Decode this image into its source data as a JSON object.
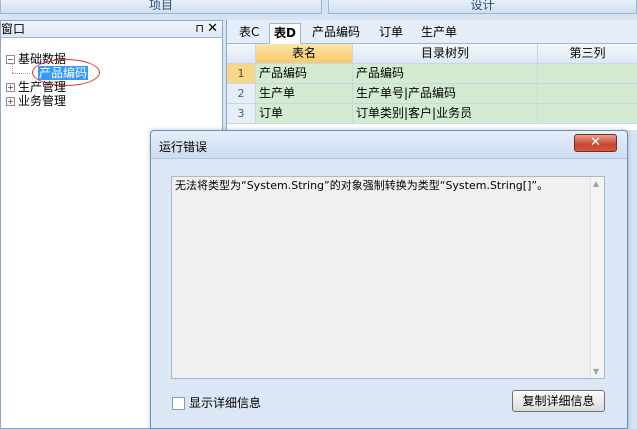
{
  "top_tabs": {
    "project": "项目",
    "design": "设计"
  },
  "left_panel": {
    "title": "窗口",
    "pin_icon": "⊓",
    "close_icon": "✕",
    "tree": [
      {
        "label": "基础数据",
        "expander": "−"
      },
      {
        "label": "产品编码"
      },
      {
        "label": "生产管理",
        "expander": "+"
      },
      {
        "label": "业务管理",
        "expander": "+"
      }
    ]
  },
  "doc_tabs": [
    "表C",
    "表D",
    "产品编码",
    "订单",
    "生产单"
  ],
  "grid": {
    "headers": [
      "表名",
      "目录树列",
      "第三列"
    ],
    "rows": [
      {
        "num": "1",
        "name": "产品编码",
        "tree_col": "产品编码",
        "third": ""
      },
      {
        "num": "2",
        "name": "生产单",
        "tree_col": "生产单号|产品编码",
        "third": ""
      },
      {
        "num": "3",
        "name": "订单",
        "tree_col": "订单类别|客户|业务员",
        "third": ""
      }
    ]
  },
  "dialog": {
    "title": "运行错误",
    "close_icon": "✕",
    "message": "无法将类型为“System.String”的对象强制转换为类型“System.String[]”。",
    "scroll_up": "▲",
    "scroll_down": "▼",
    "checkbox_label": "显示详细信息",
    "copy_button": "复制详细信息"
  },
  "colors": {
    "accent": "#3399ff",
    "error_close": "#c6452d",
    "grid_row": "#d3ebd0",
    "highlight": "#e0353b"
  }
}
